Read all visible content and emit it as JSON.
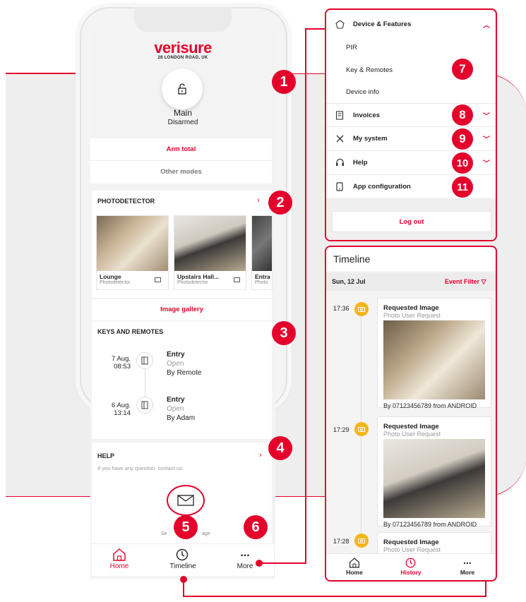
{
  "colors": {
    "brand": "#e4002b",
    "accent": "#f7b418",
    "panel": "#eeeeee"
  },
  "app": {
    "logo": "verisure",
    "address": "28 LONDON ROAD, UK"
  },
  "status": {
    "name": "Main",
    "state": "Disarmed"
  },
  "actions": {
    "arm_total": "Arm total",
    "other_modes": "Other modes"
  },
  "photodetector": {
    "title": "PHOTODETECTOR",
    "items": [
      {
        "name": "Lounge",
        "type": "Photodetector"
      },
      {
        "name": "Upstairs Hall...",
        "type": "Photodetector"
      },
      {
        "name": "Entra",
        "type": "Photo"
      }
    ],
    "gallery": "Image gallery"
  },
  "keys": {
    "title": "KEYS AND REMOTES",
    "events": [
      {
        "date": "7 Aug.",
        "time": "08:53",
        "title": "Entry",
        "state": "Open",
        "by": "By Remote"
      },
      {
        "date": "6 Aug.",
        "time": "13:14",
        "title": "Entry",
        "state": "Open",
        "by": "By Adam"
      }
    ]
  },
  "help": {
    "title": "HELP",
    "text": "If you have any question, contact us:",
    "send_left": "Se",
    "send_right": "age"
  },
  "nav": {
    "home": "Home",
    "timeline": "Timeline",
    "more": "More",
    "more_dots": "..."
  },
  "menu": {
    "device": "Device & Features",
    "subitems": [
      "PIR",
      "Key & Remotes",
      "Device info"
    ],
    "invoices": "Invoices",
    "mysystem": "My system",
    "help": "Help",
    "appconfig": "App configuration",
    "logout": "Log out"
  },
  "timeline": {
    "title": "Timeline",
    "date": "Sun, 12 Jul",
    "filter": "Event Filter",
    "events": [
      {
        "time": "17:36",
        "title": "Requested Image",
        "subtitle": "Photo User Request",
        "by": "By  07123456789  from ANDROID"
      },
      {
        "time": "17:29",
        "title": "Requested Image",
        "subtitle": "Photo User Request",
        "by": "By  07123456789  from ANDROID"
      },
      {
        "time": "17:28",
        "title": "Requested Image",
        "subtitle": "Photo User Request"
      }
    ],
    "nav": {
      "home": "Home",
      "history": "History",
      "more": "More",
      "more_dots": "..."
    }
  },
  "badges": [
    "1",
    "2",
    "3",
    "4",
    "5",
    "6",
    "7",
    "8",
    "9",
    "10",
    "11"
  ]
}
